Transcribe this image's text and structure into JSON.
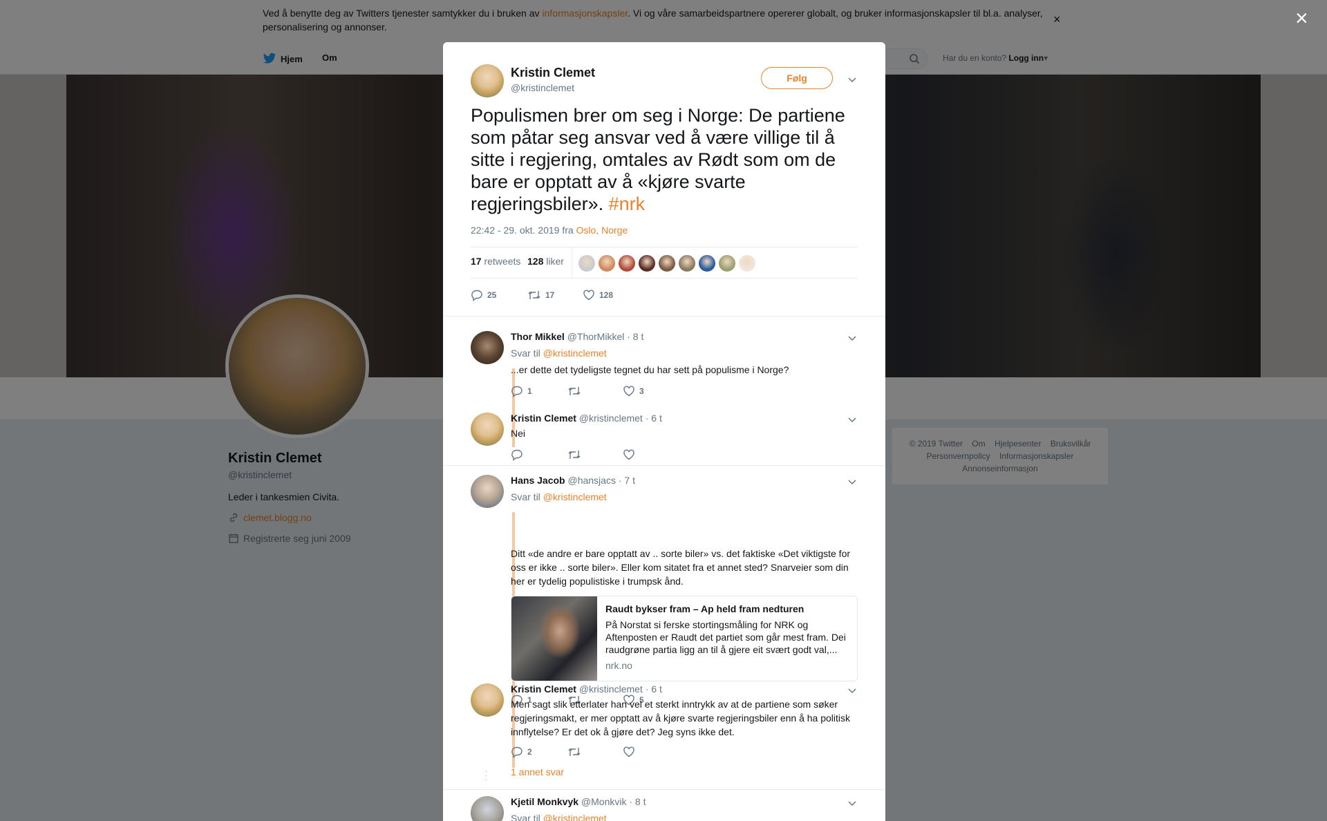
{
  "cookie_banner": {
    "text_before": "Ved å benytte deg av Twitters tjenester samtykker du i bruken av ",
    "link": "informasjonskapsler",
    "text_after": ". Vi og våre samarbeidspartnere opererer globalt, og bruker informasjonskapsler til bl.a. analyser, personalisering og annonser.",
    "close": "×"
  },
  "nav": {
    "home": "Hjem",
    "about": "Om",
    "account_prompt": "Har du en konto?",
    "login": "Logg inn"
  },
  "profile": {
    "name": "Kristin Clemet",
    "handle": "@kristinclemet",
    "bio": "Leder i tankesmien Civita.",
    "website": "clemet.blogg.no",
    "joined": "Registrerte seg juni 2009"
  },
  "footer": {
    "links": [
      "© 2019 Twitter",
      "Om",
      "Hjelpesenter",
      "Bruksvilkår",
      "Personvernpolicy",
      "Informasjonskapsler",
      "Annonseinformasjon"
    ]
  },
  "overlay_close": "×",
  "tweet": {
    "author_name": "Kristin Clemet",
    "author_handle": "@kristinclemet",
    "follow_label": "Følg",
    "text": "Populismen brer om seg i Norge: De partiene som påtar seg ansvar ved å være villige til å sitte i regjering, omtales av Rødt som om de bare er opptatt av å «kjøre svarte regjeringsbiler». ",
    "hashtag": "#nrk",
    "time": "22:42 - 29. okt. 2019 fra ",
    "location": "Oslo, Norge",
    "retweets_count": "17",
    "retweets_label": "retweets",
    "likes_count": "128",
    "likes_label": "liker",
    "reply_count": "25",
    "retweet_count": "17",
    "like_count": "128",
    "liker_colors": [
      "#c8ccd0",
      "#d08a5a",
      "#b24a3a",
      "#5a2c24",
      "#7a5a40",
      "#8a7a60",
      "#2a5aa0",
      "#9aa070",
      "#f0e6dc"
    ]
  },
  "replies": [
    {
      "name": "Thor Mikkel",
      "handle": "@ThorMikkel",
      "time": "· 8 t",
      "reply_to_prefix": "Svar til ",
      "reply_to": "@kristinclemet",
      "text": "...er dette det tydeligste tegnet du har sett på populisme i Norge?",
      "reply_count": "1",
      "retweet_count": "",
      "like_count": "3"
    },
    {
      "name": "Kristin Clemet",
      "handle": "@kristinclemet",
      "time": "· 6 t",
      "text": "Nei",
      "reply_count": "",
      "retweet_count": "",
      "like_count": ""
    },
    {
      "name": "Hans Jacob",
      "handle": "@hansjacs",
      "time": "· 7 t",
      "reply_to_prefix": "Svar til ",
      "reply_to": "@kristinclemet",
      "text": "Ditt «de andre er bare opptatt av .. sorte biler» vs. det faktiske «Det viktigste for oss er ikke .. sorte biler». Eller kom sitatet fra et annet sted? Snarveier som din her er tydelig populistiske i trumpsk ånd.",
      "card_title": "Raudt bykser fram – Ap held fram nedturen",
      "card_desc": "På Norstat si ferske stortingsmåling for NRK og Aftenposten er Raudt det partiet som går mest fram. Dei raudgrøne partia ligg an til å gjere eit svært godt val,...",
      "card_url": "nrk.no",
      "reply_count": "1",
      "retweet_count": "",
      "like_count": "5"
    },
    {
      "name": "Kristin Clemet",
      "handle": "@kristinclemet",
      "time": "· 6 t",
      "text": "Men sagt slik etterlater han vel et sterkt inntrykk av at de partiene som søker regjeringsmakt, er mer opptatt av å kjøre svarte regjeringsbiler enn å ha politisk innflytelse? Er det ok å gjøre det? Jeg syns ikke det.",
      "reply_count": "2",
      "retweet_count": "",
      "like_count": "",
      "more_replies": "1 annet svar"
    },
    {
      "name": "Kjetil Monkvyk",
      "handle": "@Monkvik",
      "time": "· 8 t",
      "reply_to_prefix": "Svar til ",
      "reply_to": "@kristinclemet"
    }
  ],
  "colors": {
    "accent": "#e8822b",
    "thread_line": "#f5c6a0",
    "muted_text": "#657786"
  }
}
